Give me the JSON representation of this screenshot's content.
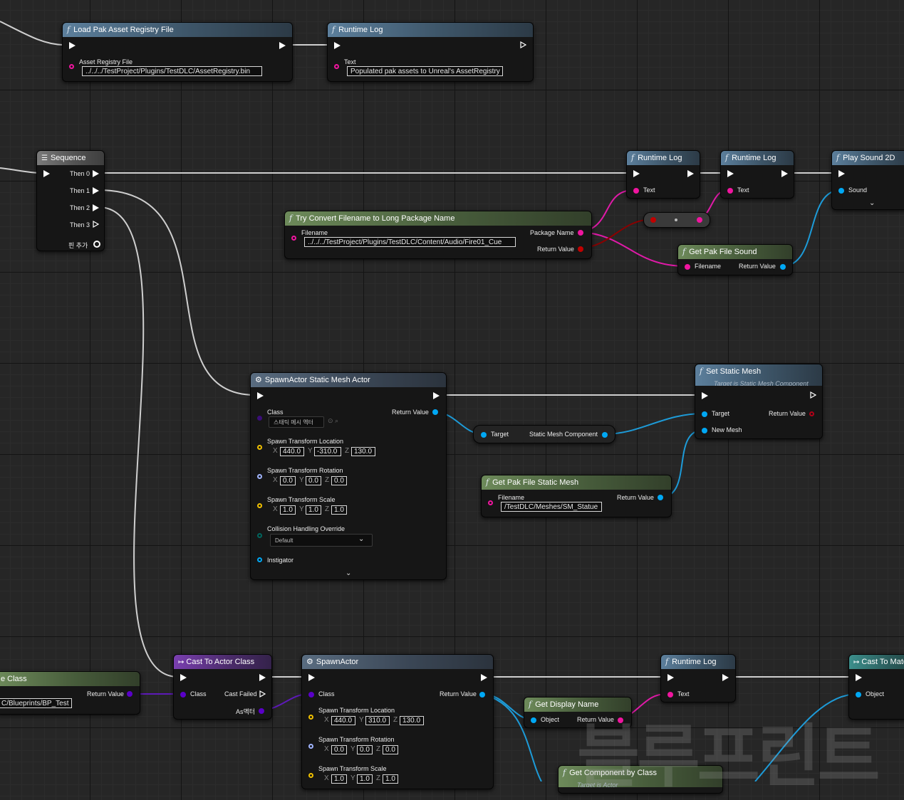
{
  "nodes": {
    "load_pak": {
      "title": "Load Pak Asset Registry File",
      "pin_label": "Asset Registry File",
      "value": "../../../TestProject/Plugins/TestDLC/AssetRegistry.bin"
    },
    "log1": {
      "title": "Runtime Log",
      "pin_label": "Text",
      "value": "Populated pak assets to Unreal's AssetRegistry"
    },
    "sequence": {
      "title": "Sequence",
      "outputs": [
        "Then 0",
        "Then 1",
        "Then 2",
        "Then 3"
      ],
      "add_pin": "핀 추가"
    },
    "try_convert": {
      "title": "Try Convert Filename to Long Package Name",
      "in_label": "Filename",
      "value": "../../../TestProject/Plugins/TestDLC/Content/Audio/Fire01_Cue",
      "out1": "Package Name",
      "out2": "Return Value"
    },
    "log2": {
      "title": "Runtime Log",
      "pin_label": "Text"
    },
    "log3": {
      "title": "Runtime Log",
      "pin_label": "Text"
    },
    "play_sound": {
      "title": "Play Sound 2D",
      "pin_label": "Sound"
    },
    "get_pak_sound": {
      "title": "Get Pak File Sound",
      "in_label": "Filename",
      "out_label": "Return Value"
    },
    "spawn_sm": {
      "title": "SpawnActor Static Mesh Actor",
      "class_label": "Class",
      "class_value": "스태틱 메시 액터",
      "return_label": "Return Value",
      "loc_label": "Spawn Transform Location",
      "loc": [
        "440.0",
        "-310.0",
        "130.0"
      ],
      "rot_label": "Spawn Transform Rotation",
      "rot": [
        "0.0",
        "0.0",
        "0.0"
      ],
      "scale_label": "Spawn Transform Scale",
      "scale": [
        "1.0",
        "1.0",
        "1.0"
      ],
      "collision_label": "Collision Handling Override",
      "collision_value": "Default",
      "instigator_label": "Instigator"
    },
    "target_node": {
      "in_label": "Target",
      "out_label": "Static Mesh Component"
    },
    "set_static_mesh": {
      "title": "Set Static Mesh",
      "subtitle": "Target is Static Mesh Component",
      "target_label": "Target",
      "return_label": "Return Value",
      "new_mesh_label": "New Mesh"
    },
    "get_pak_mesh": {
      "title": "Get Pak File Static Mesh",
      "in_label": "Filename",
      "value": "/TestDLC/Meshes/SM_Statue",
      "out_label": "Return Value"
    },
    "class_node": {
      "title": "e Class",
      "out_label": "Return Value",
      "value": "C/Blueprints/BP_Test"
    },
    "cast_actor": {
      "title": "Cast To Actor Class",
      "class_label": "Class",
      "fail_label": "Cast Failed",
      "as_label": "As액터"
    },
    "spawn_actor": {
      "title": "SpawnActor",
      "class_label": "Class",
      "return_label": "Return Value",
      "loc_label": "Spawn Transform Location",
      "loc": [
        "440.0",
        "310.0",
        "130.0"
      ],
      "rot_label": "Spawn Transform Rotation",
      "rot": [
        "0.0",
        "0.0",
        "0.0"
      ],
      "scale_label": "Spawn Transform Scale",
      "scale": [
        "1.0",
        "1.0",
        "1.0"
      ]
    },
    "get_display": {
      "title": "Get Display Name",
      "in_label": "Object",
      "out_label": "Return Value"
    },
    "log4": {
      "title": "Runtime Log",
      "pin_label": "Text"
    },
    "cast_mate": {
      "title": "Cast To Mate",
      "in_label": "Object"
    },
    "get_component": {
      "title": "Get Component by Class",
      "subtitle": "Target is Actor"
    }
  },
  "axis_labels": {
    "x": "X",
    "y": "Y",
    "z": "Z"
  },
  "watermark": "블루프린트",
  "colors": {
    "exec": "#ffffff",
    "string": "#f0159f",
    "object": "#00a8f4",
    "class": "#5a00c8",
    "vector": "#f0c000",
    "rotator": "#a0b4ff",
    "enum": "#00665e",
    "name": "#c00000"
  }
}
